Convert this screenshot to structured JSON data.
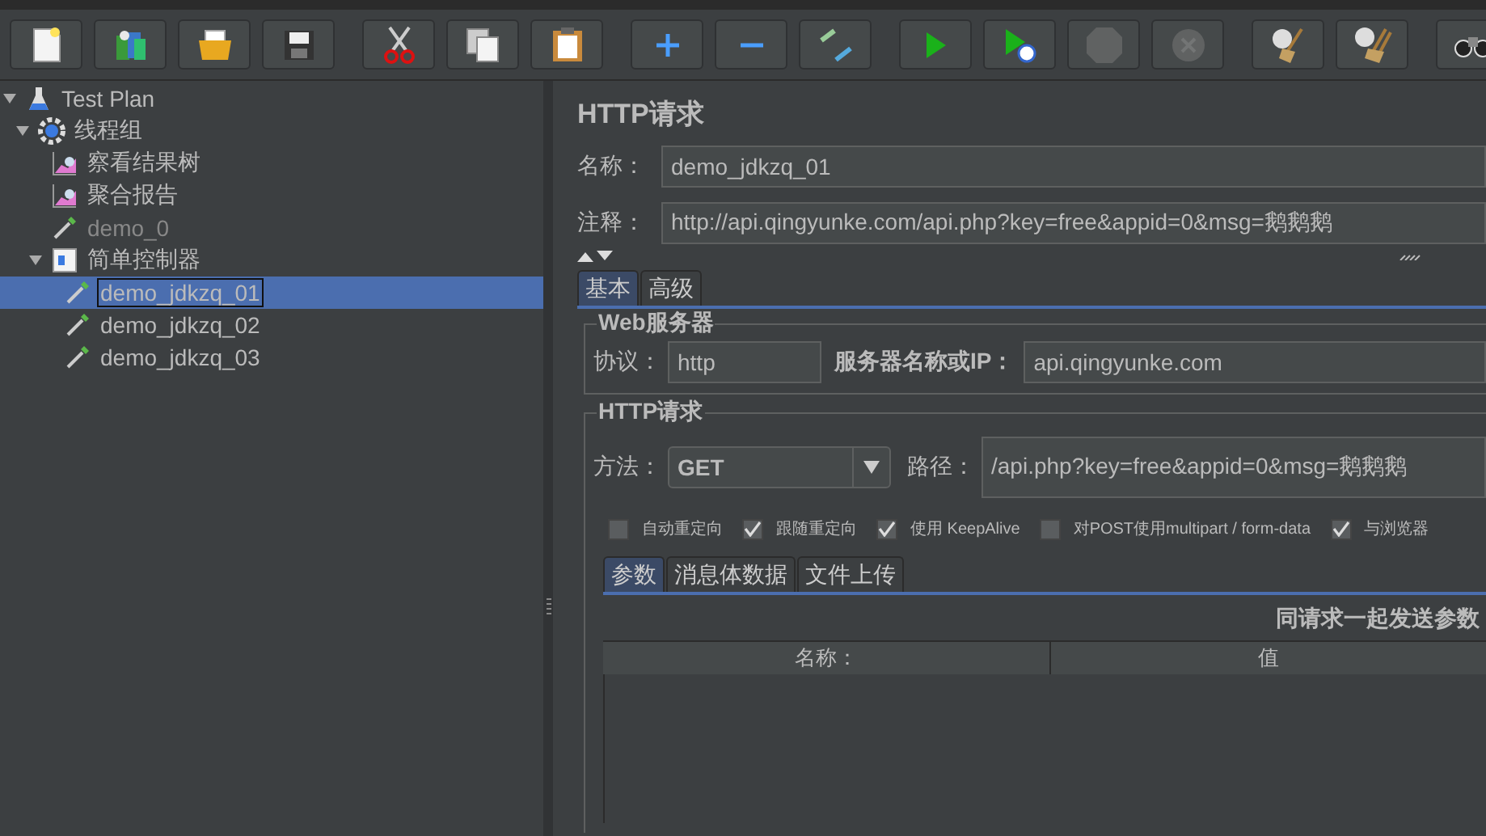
{
  "toolbar": {
    "groups": [
      [
        {
          "disabled": false
        },
        {
          "disabled": false
        },
        {
          "disabled": false
        },
        {
          "disabled": false
        }
      ],
      [
        {
          "disabled": false
        },
        {
          "disabled": false
        },
        {
          "disabled": false
        }
      ],
      [
        {
          "disabled": false
        },
        {
          "disabled": false
        },
        {
          "disabled": false
        }
      ],
      [
        {
          "disabled": false
        },
        {
          "disabled": false
        },
        {
          "disabled": true
        },
        {
          "disabled": true
        }
      ],
      [
        {
          "disabled": false
        },
        {
          "disabled": false
        }
      ],
      [
        {
          "disabled": false
        }
      ]
    ]
  },
  "tree": [
    {
      "label": "Test Plan",
      "kind": "plan",
      "expanded": true,
      "selected": false,
      "disabled": false,
      "children": [
        {
          "label": "线程组",
          "kind": "threads",
          "expanded": true,
          "selected": false,
          "disabled": false,
          "children": [
            {
              "label": "察看结果树",
              "kind": "listener",
              "selected": false,
              "disabled": false
            },
            {
              "label": "聚合报告",
              "kind": "listener",
              "selected": false,
              "disabled": false
            },
            {
              "label": "demo_0",
              "kind": "sampler",
              "selected": false,
              "disabled": true
            },
            {
              "label": "简单控制器",
              "kind": "controller",
              "expanded": true,
              "selected": false,
              "disabled": false,
              "children": [
                {
                  "label": "demo_jdkzq_01",
                  "kind": "sampler",
                  "selected": true,
                  "disabled": false
                },
                {
                  "label": "demo_jdkzq_02",
                  "kind": "sampler",
                  "selected": false,
                  "disabled": false
                },
                {
                  "label": "demo_jdkzq_03",
                  "kind": "sampler",
                  "selected": false,
                  "disabled": false
                }
              ]
            }
          ]
        }
      ]
    }
  ],
  "editor": {
    "title": "HTTP请求",
    "name": {
      "label": "名称：",
      "value": "demo_jdkzq_01"
    },
    "comment": {
      "label": "注释：",
      "value": "http://api.qingyunke.com/api.php?key=free&appid=0&msg=鹅鹅鹅"
    },
    "tabs": [
      {
        "label": "基本",
        "selected": true
      },
      {
        "label": "高级",
        "selected": false
      }
    ],
    "web_server": {
      "legend": "Web服务器",
      "protocol": {
        "label": "协议：",
        "value": "http"
      },
      "server": {
        "label": "服务器名称或IP：",
        "value": "api.qingyunke.com"
      }
    },
    "http_request": {
      "legend": "HTTP请求",
      "method": {
        "label": "方法：",
        "value": "GET"
      },
      "path": {
        "label": "路径：",
        "value": "/api.php?key=free&appid=0&msg=鹅鹅鹅"
      },
      "options": [
        {
          "label": "自动重定向",
          "checked": false
        },
        {
          "label": "跟随重定向",
          "checked": true
        },
        {
          "label": "使用 KeepAlive",
          "checked": true
        },
        {
          "label": "对POST使用multipart / form-data",
          "checked": false
        },
        {
          "label": "与浏览器",
          "checked": true
        }
      ]
    },
    "param_tabs": [
      {
        "label": "参数",
        "selected": true
      },
      {
        "label": "消息体数据",
        "selected": false
      },
      {
        "label": "文件上传",
        "selected": false
      }
    ],
    "params_caption": "同请求一起发送参数",
    "table": {
      "columns": [
        "名称：",
        "值"
      ]
    }
  }
}
